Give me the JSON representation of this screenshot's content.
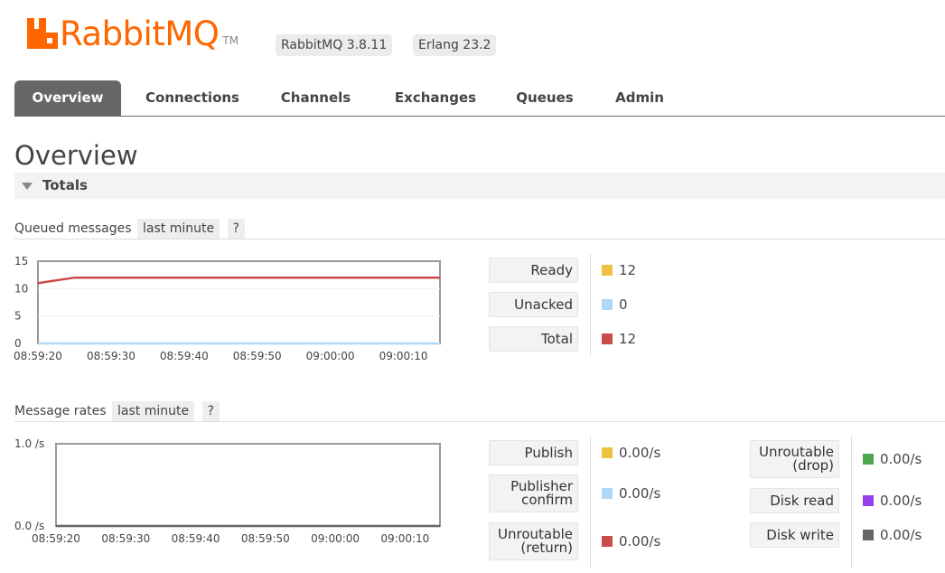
{
  "header": {
    "logo_text": "RabbitMQ",
    "logo_tm": "TM",
    "version": "RabbitMQ 3.8.11",
    "erlang": "Erlang 23.2",
    "brand_color": "#ff6600"
  },
  "tabs": [
    {
      "label": "Overview",
      "active": true
    },
    {
      "label": "Connections",
      "active": false
    },
    {
      "label": "Channels",
      "active": false
    },
    {
      "label": "Exchanges",
      "active": false
    },
    {
      "label": "Queues",
      "active": false
    },
    {
      "label": "Admin",
      "active": false
    }
  ],
  "page": {
    "title": "Overview",
    "totals_label": "Totals"
  },
  "queued": {
    "label": "Queued messages",
    "range": "last minute",
    "help": "?",
    "legend": [
      {
        "label": "Ready",
        "value": "12",
        "color": "#edc240"
      },
      {
        "label": "Unacked",
        "value": "0",
        "color": "#afd8f8"
      },
      {
        "label": "Total",
        "value": "12",
        "color": "#cb4b4b"
      }
    ]
  },
  "rates": {
    "label": "Message rates",
    "range": "last minute",
    "help": "?",
    "legend_left": [
      {
        "label": "Publish",
        "value": "0.00/s",
        "color": "#edc240"
      },
      {
        "label": "Publisher confirm",
        "value": "0.00/s",
        "color": "#afd8f8"
      },
      {
        "label": "Unroutable (return)",
        "value": "0.00/s",
        "color": "#cb4b4b"
      }
    ],
    "legend_right": [
      {
        "label": "Unroutable (drop)",
        "value": "0.00/s",
        "color": "#4da74d"
      },
      {
        "label": "Disk read",
        "value": "0.00/s",
        "color": "#9440ed"
      },
      {
        "label": "Disk write",
        "value": "0.00/s",
        "color": "#666666"
      }
    ]
  },
  "chart_data": [
    {
      "type": "line",
      "x": [
        "08:59:20",
        "08:59:25",
        "08:59:30",
        "08:59:35",
        "08:59:40",
        "08:59:45",
        "08:59:50",
        "08:59:55",
        "09:00:00",
        "09:00:05",
        "09:00:10",
        "09:00:15"
      ],
      "x_ticks": [
        "08:59:20",
        "08:59:30",
        "08:59:40",
        "08:59:50",
        "09:00:00",
        "09:00:10"
      ],
      "y_ticks": [
        "15",
        "10",
        "5",
        "0"
      ],
      "ylim": [
        0,
        15
      ],
      "series": [
        {
          "name": "Total",
          "color": "#cb4b4b",
          "values": [
            11,
            12,
            12,
            12,
            12,
            12,
            12,
            12,
            12,
            12,
            12,
            12
          ]
        },
        {
          "name": "Unacked",
          "color": "#afd8f8",
          "values": [
            0,
            0,
            0,
            0,
            0,
            0,
            0,
            0,
            0,
            0,
            0,
            0
          ]
        }
      ]
    },
    {
      "type": "line",
      "x": [
        "08:59:20",
        "08:59:25",
        "08:59:30",
        "08:59:35",
        "08:59:40",
        "08:59:45",
        "08:59:50",
        "08:59:55",
        "09:00:00",
        "09:00:05",
        "09:00:10",
        "09:00:15"
      ],
      "x_ticks": [
        "08:59:20",
        "08:59:30",
        "08:59:40",
        "08:59:50",
        "09:00:00",
        "09:00:10"
      ],
      "y_ticks": [
        "1.0 /s",
        "0.0 /s"
      ],
      "ylim": [
        0,
        1
      ],
      "series": [
        {
          "name": "Disk write",
          "color": "#666666",
          "values": [
            0,
            0,
            0,
            0,
            0,
            0,
            0,
            0,
            0,
            0,
            0,
            0
          ]
        }
      ]
    }
  ]
}
